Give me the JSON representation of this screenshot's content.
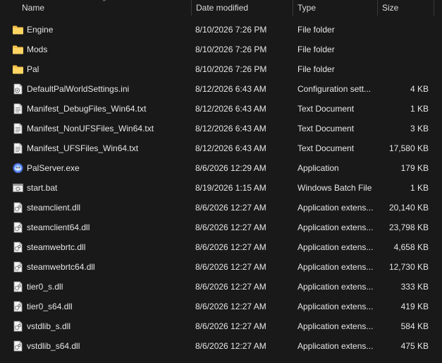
{
  "columns": {
    "name": "Name",
    "date": "Date modified",
    "type": "Type",
    "size": "Size"
  },
  "files": [
    {
      "name": "Engine",
      "date": "8/10/2026 7:26 PM",
      "type": "File folder",
      "size": "",
      "icon": "folder-icon"
    },
    {
      "name": "Mods",
      "date": "8/10/2026 7:26 PM",
      "type": "File folder",
      "size": "",
      "icon": "folder-icon"
    },
    {
      "name": "Pal",
      "date": "8/10/2026 7:26 PM",
      "type": "File folder",
      "size": "",
      "icon": "folder-icon"
    },
    {
      "name": "DefaultPalWorldSettings.ini",
      "date": "8/12/2026 6:43 AM",
      "type": "Configuration sett...",
      "size": "4 KB",
      "icon": "config-file-icon"
    },
    {
      "name": "Manifest_DebugFiles_Win64.txt",
      "date": "8/12/2026 6:43 AM",
      "type": "Text Document",
      "size": "1 KB",
      "icon": "text-file-icon"
    },
    {
      "name": "Manifest_NonUFSFiles_Win64.txt",
      "date": "8/12/2026 6:43 AM",
      "type": "Text Document",
      "size": "3 KB",
      "icon": "text-file-icon"
    },
    {
      "name": "Manifest_UFSFiles_Win64.txt",
      "date": "8/12/2026 6:43 AM",
      "type": "Text Document",
      "size": "17,580 KB",
      "icon": "text-file-icon"
    },
    {
      "name": "PalServer.exe",
      "date": "8/6/2026 12:29 AM",
      "type": "Application",
      "size": "179 KB",
      "icon": "app-icon"
    },
    {
      "name": "start.bat",
      "date": "8/19/2026 1:15 AM",
      "type": "Windows Batch File",
      "size": "1 KB",
      "icon": "batch-file-icon"
    },
    {
      "name": "steamclient.dll",
      "date": "8/6/2026 12:27 AM",
      "type": "Application extens...",
      "size": "20,140 KB",
      "icon": "dll-file-icon"
    },
    {
      "name": "steamclient64.dll",
      "date": "8/6/2026 12:27 AM",
      "type": "Application extens...",
      "size": "23,798 KB",
      "icon": "dll-file-icon"
    },
    {
      "name": "steamwebrtc.dll",
      "date": "8/6/2026 12:27 AM",
      "type": "Application extens...",
      "size": "4,658 KB",
      "icon": "dll-file-icon"
    },
    {
      "name": "steamwebrtc64.dll",
      "date": "8/6/2026 12:27 AM",
      "type": "Application extens...",
      "size": "12,730 KB",
      "icon": "dll-file-icon"
    },
    {
      "name": "tier0_s.dll",
      "date": "8/6/2026 12:27 AM",
      "type": "Application extens...",
      "size": "333 KB",
      "icon": "dll-file-icon"
    },
    {
      "name": "tier0_s64.dll",
      "date": "8/6/2026 12:27 AM",
      "type": "Application extens...",
      "size": "419 KB",
      "icon": "dll-file-icon"
    },
    {
      "name": "vstdlib_s.dll",
      "date": "8/6/2026 12:27 AM",
      "type": "Application extens...",
      "size": "584 KB",
      "icon": "dll-file-icon"
    },
    {
      "name": "vstdlib_s64.dll",
      "date": "8/6/2026 12:27 AM",
      "type": "Application extens...",
      "size": "475 KB",
      "icon": "dll-file-icon"
    }
  ],
  "colors": {
    "background": "#191919",
    "text": "#e6e6e6",
    "folder": "#f2c04b"
  }
}
